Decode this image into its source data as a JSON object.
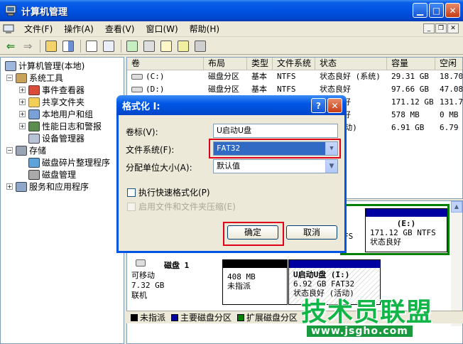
{
  "window": {
    "title": "计算机管理"
  },
  "menubar": {
    "items": [
      "文件(F)",
      "操作(A)",
      "查看(V)",
      "窗口(W)",
      "帮助(H)"
    ]
  },
  "toolbar": {
    "icons": [
      "back-arrow-icon",
      "forward-arrow-icon",
      "up-folder-icon",
      "show-tree-icon",
      "properties-icon",
      "help-icon",
      "refresh-icon",
      "export-icon",
      "new-icon",
      "search-icon",
      "disk-settings-icon"
    ]
  },
  "tree": {
    "items": [
      {
        "label": "计算机管理(本地)"
      },
      {
        "label": "系统工具"
      },
      {
        "label": "事件查看器"
      },
      {
        "label": "共享文件夹"
      },
      {
        "label": "本地用户和组"
      },
      {
        "label": "性能日志和警报"
      },
      {
        "label": "设备管理器"
      },
      {
        "label": "存储"
      },
      {
        "label": "磁盘碎片整理程序"
      },
      {
        "label": "磁盘管理"
      },
      {
        "label": "服务和应用程序"
      }
    ]
  },
  "volumes": {
    "headers": [
      "卷",
      "布局",
      "类型",
      "文件系统",
      "状态",
      "容量",
      "空闲"
    ],
    "rows": [
      {
        "vol": "(C:)",
        "layout": "磁盘分区",
        "type": "基本",
        "fs": "NTFS",
        "status": "状态良好 (系统)",
        "cap": "29.31 GB",
        "free": "18.70"
      },
      {
        "vol": "(D:)",
        "layout": "磁盘分区",
        "type": "基本",
        "fs": "NTFS",
        "status": "状态良好",
        "cap": "97.66 GB",
        "free": "47.08"
      },
      {
        "vol": "",
        "layout": "",
        "type": "",
        "fs": "",
        "status": "状态良好",
        "cap": "171.12 GB",
        "free": "131.70"
      },
      {
        "vol": "",
        "layout": "",
        "type": "",
        "fs": "",
        "status": "状态良好",
        "cap": "578 MB",
        "free": "0 MB"
      },
      {
        "vol": "",
        "layout": "",
        "type": "",
        "fs": "",
        "status": "好 (活动)",
        "cap": "6.91 GB",
        "free": "6.79"
      }
    ]
  },
  "graphical": {
    "vol_e": {
      "name": "(E:)",
      "size": "171.12 GB NTFS",
      "status": "状态良好"
    },
    "vol_partial": "FS",
    "disk1": {
      "name": "磁盘 1",
      "type": "可移动",
      "size": "7.32 GB",
      "state": "联机"
    },
    "unalloc": {
      "size": "408 MB",
      "label": "未指派"
    },
    "vol_i": {
      "name": "U启动U盘 (I:)",
      "size": "6.92 GB FAT32",
      "status": "状态良好 (活动)"
    }
  },
  "legend": {
    "items": [
      "未指派",
      "主要磁盘分区",
      "扩展磁盘分区"
    ]
  },
  "colors": {
    "unallocated": "#000000",
    "primary": "#0000a0",
    "extended": "#008000",
    "highlight": "#e0001a"
  },
  "dialog": {
    "title": "格式化 I:",
    "volume_label": "卷标(V):",
    "volume_value": "U启动U盘",
    "fs_label": "文件系统(F):",
    "fs_value": "FAT32",
    "alloc_label": "分配单位大小(A):",
    "alloc_value": "默认值",
    "quick_format": "执行快速格式化(P)",
    "compression": "启用文件和文件夹压缩(E)",
    "ok": "确定",
    "cancel": "取消"
  },
  "watermark": {
    "text": "技术员联盟",
    "url": "www.jsgho.com"
  }
}
